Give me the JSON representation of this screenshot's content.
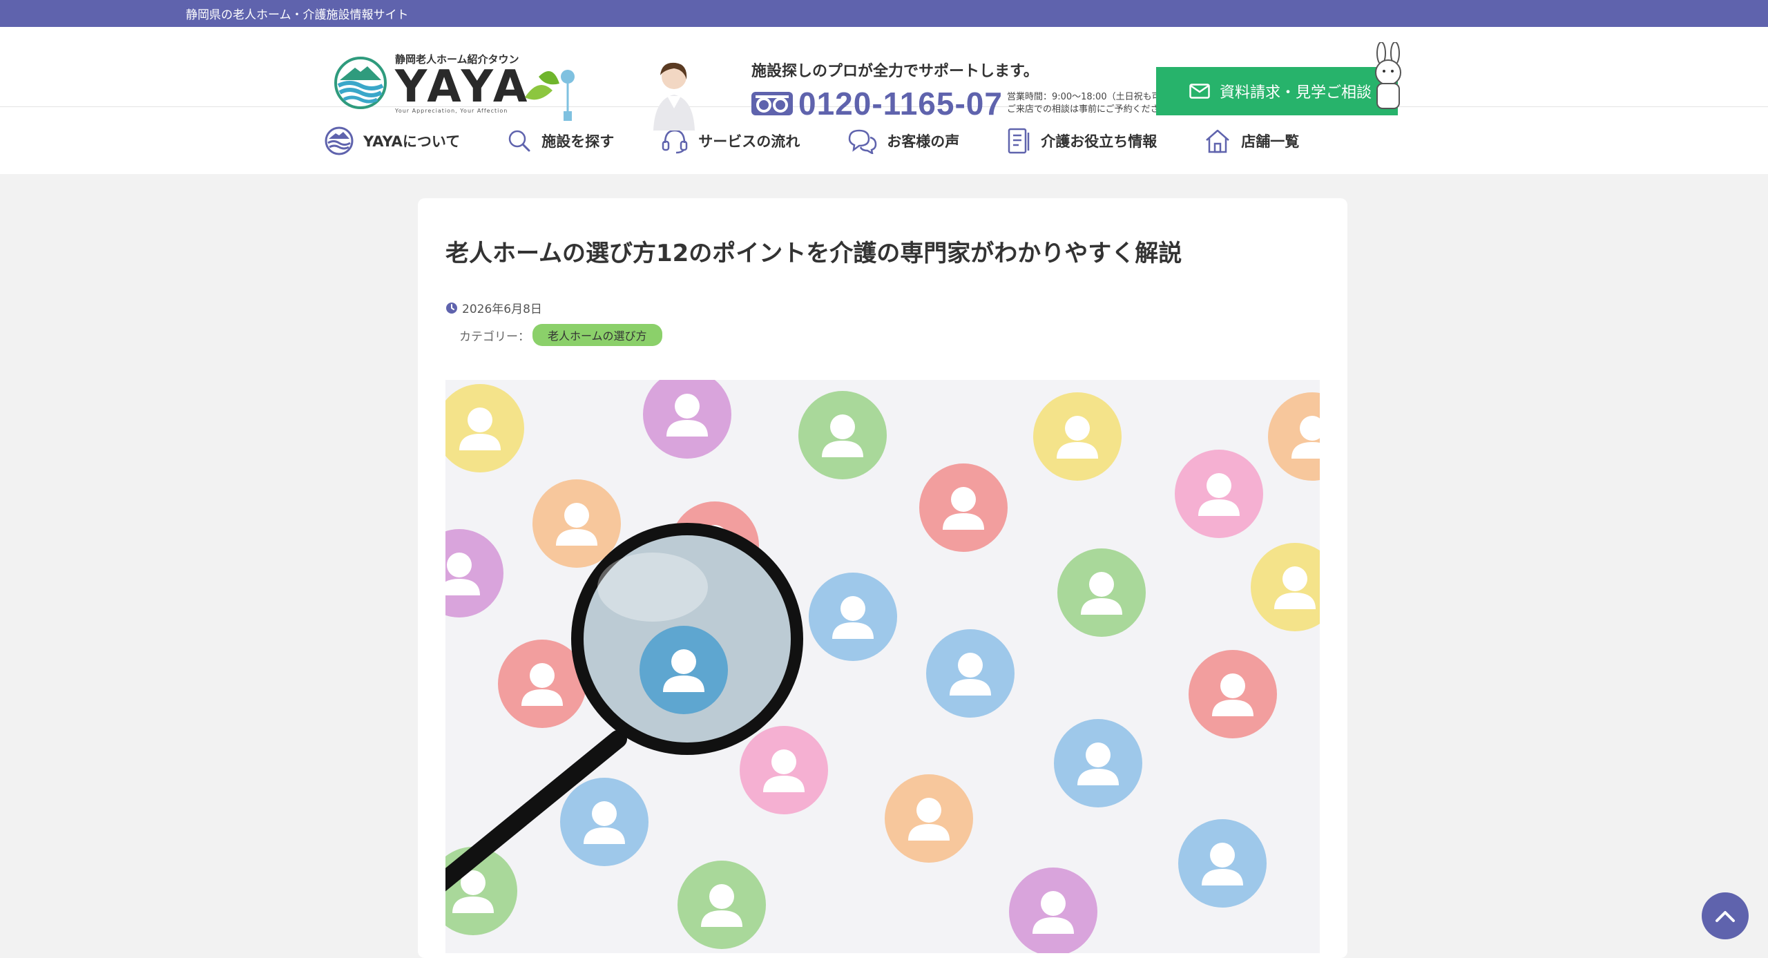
{
  "topbar": {
    "text": "静岡県の老人ホーム・介護施設情報サイト"
  },
  "logo": {
    "sub": "静岡老人ホーム紹介タウン",
    "main": "YAYA",
    "tagline": "Your Appreciation, Your Affection"
  },
  "support": {
    "headline": "施設探しのプロが全力でサポートします。",
    "phone": "0120-1165-07",
    "hours_line1": "営業時間：9:00〜18:00（土日祝も可）",
    "hours_line2": "ご来店での相談は事前にご予約ください。"
  },
  "cta": {
    "label": "資料請求・見学ご相談"
  },
  "nav": {
    "items": [
      {
        "label": "YAYAについて",
        "icon": "yaya-logo-icon"
      },
      {
        "label": "施設を探す",
        "icon": "search-icon"
      },
      {
        "label": "サービスの流れ",
        "icon": "headset-icon"
      },
      {
        "label": "お客様の声",
        "icon": "chat-bubbles-icon"
      },
      {
        "label": "介護お役立ち情報",
        "icon": "document-icon"
      },
      {
        "label": "店舗一覧",
        "icon": "home-icon"
      }
    ]
  },
  "article": {
    "title": "老人ホームの選び方12のポイントを介護の専門家がわかりやすく解説",
    "date": "2026年6月8日",
    "category_label": "カテゴリー：",
    "category": "老人ホームの選び方"
  },
  "colors": {
    "brand": "#5f63ad",
    "cta": "#27b36b",
    "badge": "#8bd06a"
  }
}
